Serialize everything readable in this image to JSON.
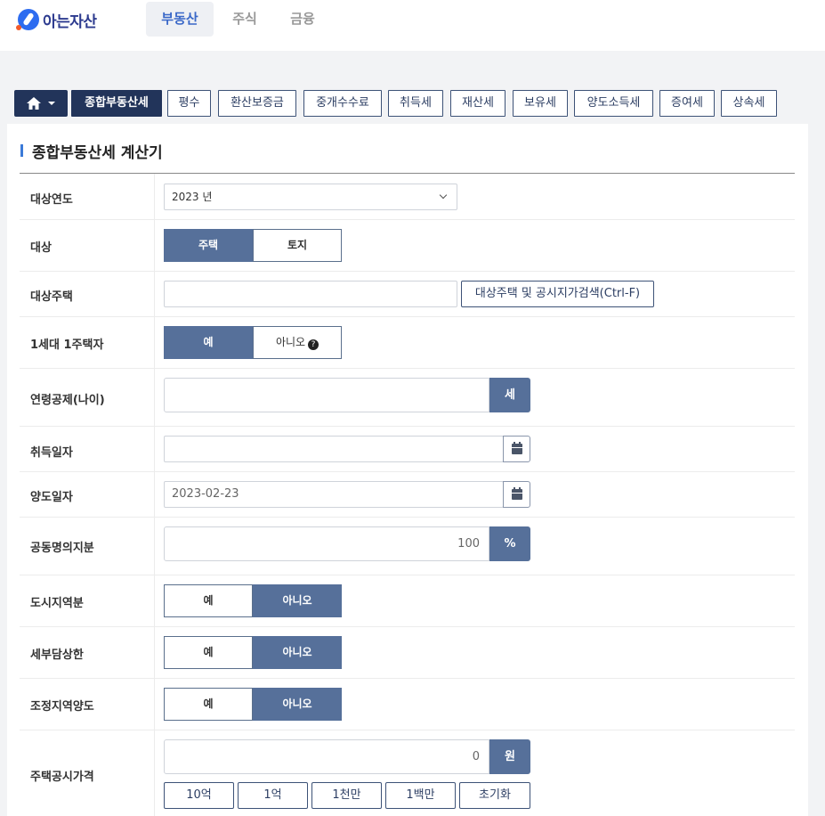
{
  "brand": {
    "name": "아는자산"
  },
  "top_nav": [
    {
      "label": "부동산",
      "active": true
    },
    {
      "label": "주식",
      "active": false
    },
    {
      "label": "금융",
      "active": false
    }
  ],
  "sub_tabs": [
    {
      "label": "종합부동산세",
      "active": true
    },
    {
      "label": "평수"
    },
    {
      "label": "환산보증금"
    },
    {
      "label": "중개수수료"
    },
    {
      "label": "취득세"
    },
    {
      "label": "재산세"
    },
    {
      "label": "보유세"
    },
    {
      "label": "양도소득세"
    },
    {
      "label": "증여세"
    },
    {
      "label": "상속세"
    }
  ],
  "panel": {
    "title": "종합부동산세 계산기"
  },
  "form": {
    "year": {
      "label": "대상연도",
      "value": "2023 년"
    },
    "target": {
      "label": "대상",
      "options": [
        "주택",
        "토지"
      ],
      "selected": "주택"
    },
    "house": {
      "label": "대상주택",
      "value": "",
      "search_label": "대상주택 및 공시지가검색(Ctrl-F)"
    },
    "one_house": {
      "label": "1세대 1주택자",
      "yes": "예",
      "no": "아니오",
      "selected": "예"
    },
    "age": {
      "label": "연령공제(나이)",
      "value": "",
      "unit": "세"
    },
    "acquire_date": {
      "label": "취득일자",
      "value": ""
    },
    "transfer_date": {
      "label": "양도일자",
      "value": "2023-02-23"
    },
    "joint_share": {
      "label": "공동명의지분",
      "value": "100",
      "unit": "%"
    },
    "urban": {
      "label": "도시지역분",
      "yes": "예",
      "no": "아니오",
      "selected": "아니오"
    },
    "tax_cap": {
      "label": "세부담상한",
      "yes": "예",
      "no": "아니오",
      "selected": "아니오"
    },
    "adjusted_area": {
      "label": "조정지역양도",
      "yes": "예",
      "no": "아니오",
      "selected": "아니오"
    },
    "price": {
      "label": "주택공시가격",
      "value": "0",
      "unit": "원",
      "quick_buttons": [
        "10억",
        "1억",
        "1천만",
        "1백만",
        "초기화"
      ]
    }
  },
  "colors": {
    "navy": "#22345a",
    "accent": "#56709a",
    "brand_blue": "#2d6cf0"
  }
}
